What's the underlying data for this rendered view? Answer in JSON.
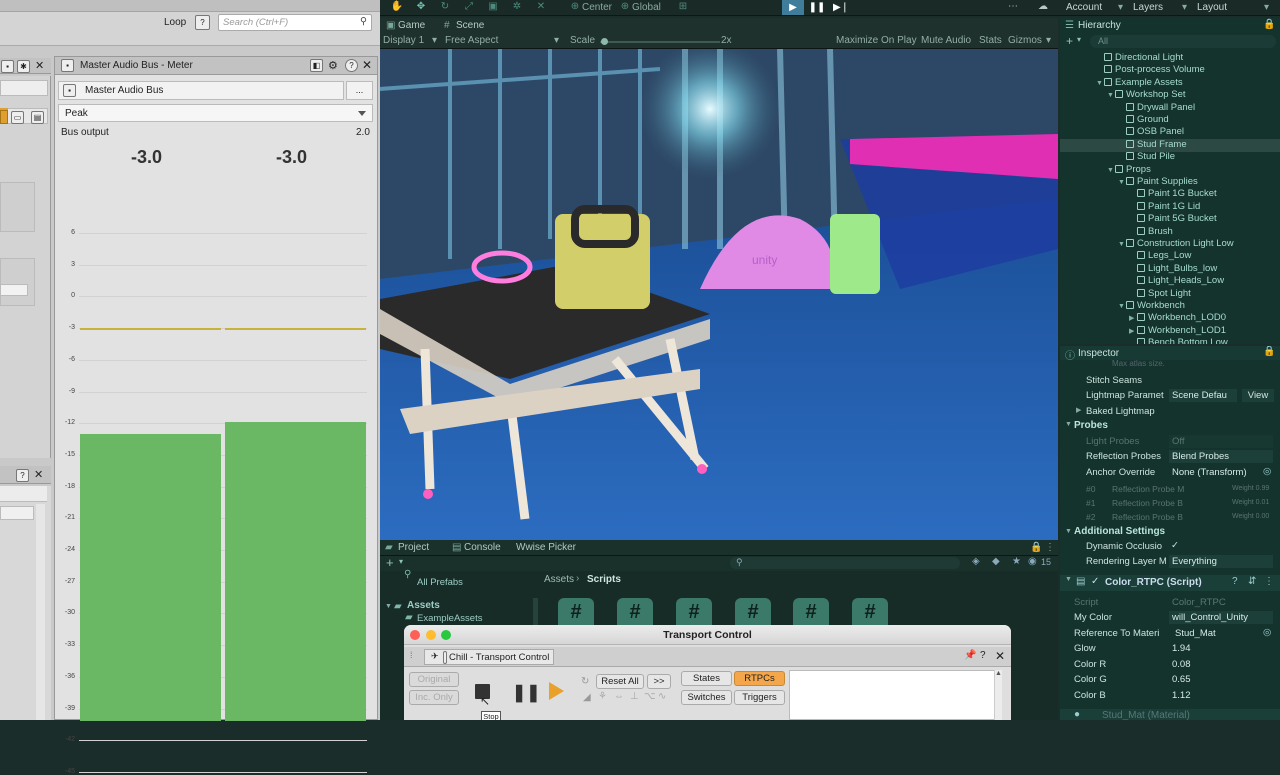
{
  "wwise": {
    "loop_label": "Loop",
    "help_label": "?",
    "search_placeholder": "Search (Ctrl+F)",
    "meter": {
      "title": "Master Audio Bus - Meter",
      "bus_name": "Master Audio Bus",
      "dots_label": "...",
      "mode": "Peak",
      "bus_output_label": "Bus output",
      "bus_output_value": "2.0",
      "left_peak": "-3.0",
      "right_peak": "-3.0",
      "scale": [
        "6",
        "3",
        "0",
        "-3",
        "-6",
        "-9",
        "-12",
        "-15",
        "-18",
        "-21",
        "-24",
        "-27",
        "-30",
        "-33",
        "-36",
        "-39",
        "-42",
        "-45"
      ],
      "left_level_db": -13.0,
      "right_level_db": -11.9,
      "peak_hold_db": -3.0,
      "bar_color": "#6ab764"
    }
  },
  "unity": {
    "toolbar": {
      "center_label": "Center",
      "global_label": "Global",
      "account_label": "Account",
      "layers_label": "Layers",
      "layout_label": "Layout"
    },
    "game": {
      "tab_game": "Game",
      "tab_scene": "Scene",
      "display": "Display 1",
      "aspect": "Free Aspect",
      "scale_label": "Scale",
      "scale_value": "2x",
      "maximize": "Maximize On Play",
      "mute": "Mute Audio",
      "stats": "Stats",
      "gizmos": "Gizmos",
      "helmet_text": "unity"
    },
    "hierarchy": {
      "title": "Hierarchy",
      "search": "All",
      "items": [
        {
          "label": "Directional Light",
          "indent": 0,
          "arrow": ""
        },
        {
          "label": "Post-process Volume",
          "indent": 0,
          "arrow": ""
        },
        {
          "label": "Example Assets",
          "indent": 0,
          "arrow": "▼"
        },
        {
          "label": "Workshop Set",
          "indent": 1,
          "arrow": "▼"
        },
        {
          "label": "Drywall Panel",
          "indent": 2,
          "arrow": ""
        },
        {
          "label": "Ground",
          "indent": 2,
          "arrow": ""
        },
        {
          "label": "OSB Panel",
          "indent": 2,
          "arrow": ""
        },
        {
          "label": "Stud Frame",
          "indent": 2,
          "arrow": ""
        },
        {
          "label": "Stud Pile",
          "indent": 2,
          "arrow": ""
        },
        {
          "label": "Props",
          "indent": 1,
          "arrow": "▼"
        },
        {
          "label": "Paint Supplies",
          "indent": 2,
          "arrow": "▼"
        },
        {
          "label": "Paint 1G Bucket",
          "indent": 3,
          "arrow": ""
        },
        {
          "label": "Paint 1G Lid",
          "indent": 3,
          "arrow": ""
        },
        {
          "label": "Paint 5G Bucket",
          "indent": 3,
          "arrow": ""
        },
        {
          "label": "Brush",
          "indent": 3,
          "arrow": ""
        },
        {
          "label": "Construction Light Low",
          "indent": 2,
          "arrow": "▼"
        },
        {
          "label": "Legs_Low",
          "indent": 3,
          "arrow": ""
        },
        {
          "label": "Light_Bulbs_low",
          "indent": 3,
          "arrow": ""
        },
        {
          "label": "Light_Heads_Low",
          "indent": 3,
          "arrow": ""
        },
        {
          "label": "Spot Light",
          "indent": 3,
          "arrow": ""
        },
        {
          "label": "Workbench",
          "indent": 2,
          "arrow": "▼"
        },
        {
          "label": "Workbench_LOD0",
          "indent": 3,
          "arrow": "▶"
        },
        {
          "label": "Workbench_LOD1",
          "indent": 3,
          "arrow": "▶"
        },
        {
          "label": "Bench Bottom Low",
          "indent": 3,
          "arrow": ""
        }
      ]
    },
    "inspector": {
      "title": "Inspector",
      "max_atlas": "Max atlas size.",
      "stitch_seams": "Stitch Seams",
      "lightmap_params": "Lightmap Paramet",
      "lightmap_params_value": "Scene Defau",
      "view_label": "View",
      "baked_lightmap": "Baked Lightmap",
      "probes_section": "Probes",
      "light_probes": "Light Probes",
      "light_probes_value": "Off",
      "reflection_probes": "Reflection Probes",
      "reflection_probes_value": "Blend Probes",
      "anchor_override": "Anchor Override",
      "anchor_override_value": "None (Transform)",
      "probe_rows": [
        {
          "id": "#0",
          "label": "Reflection Probe M",
          "weight": "Weight 0.99"
        },
        {
          "id": "#1",
          "label": "Reflection Probe B",
          "weight": "Weight 0.01"
        },
        {
          "id": "#2",
          "label": "Reflection Probe B",
          "weight": "Weight 0.00"
        }
      ],
      "additional_section": "Additional Settings",
      "dynamic_occlusion": "Dynamic Occlusio",
      "rendering_layer": "Rendering Layer M",
      "rendering_layer_value": "Everything",
      "component_title": "Color_RTPC (Script)",
      "script_label": "Script",
      "script_value": "Color_RTPC",
      "my_color": "My Color",
      "my_color_value": "will_Control_Unity",
      "reference_label": "Reference To Materi",
      "reference_value": "Stud_Mat",
      "glow_label": "Glow",
      "glow_value": "1.94",
      "color_r_label": "Color R",
      "color_r_value": "0.08",
      "color_g_label": "Color G",
      "color_g_value": "0.65",
      "color_b_label": "Color B",
      "color_b_value": "1.12",
      "material_label": "Stud_Mat (Material)"
    },
    "project": {
      "tab_project": "Project",
      "tab_console": "Console",
      "tab_wwise": "Wwise Picker",
      "all_prefabs": "All Prefabs",
      "assets_folder": "Assets",
      "example_assets": "ExampleAssets",
      "breadcrumb_assets": "Assets",
      "breadcrumb_scripts": "Scripts",
      "badge_count": "15",
      "script_glyph": "#"
    }
  },
  "transport": {
    "title": "Transport Control",
    "tab_label": "Chill - Transport Control",
    "original": "Original",
    "inc_only": "Inc. Only",
    "reset_all": "Reset All",
    "more": ">>",
    "states": "States",
    "rtpcs": "RTPCs",
    "switches": "Switches",
    "triggers": "Triggers",
    "tooltip": "Stop",
    "active_color": "#f4a64a"
  }
}
